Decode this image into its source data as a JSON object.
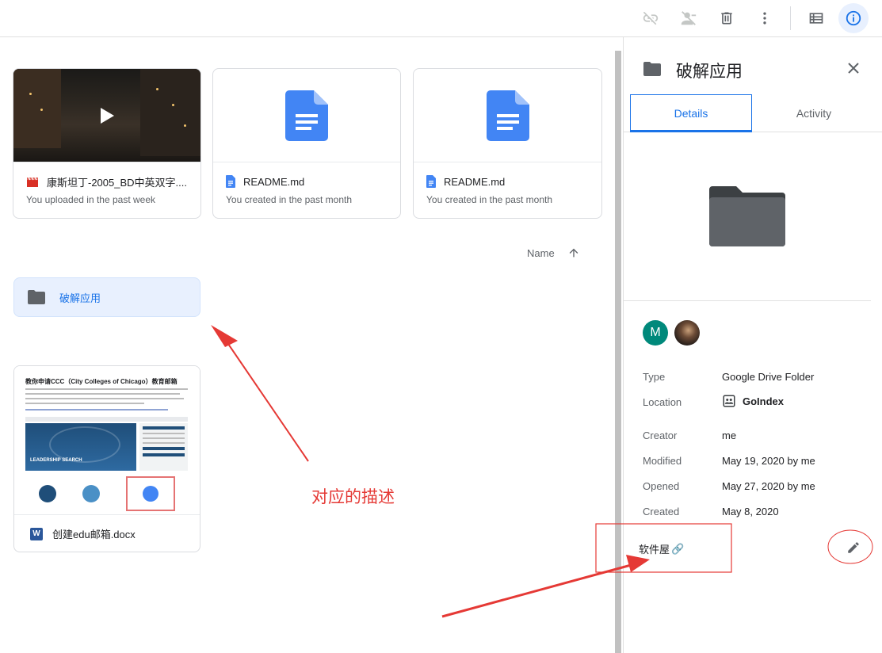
{
  "toolbar": {
    "icons": [
      "link-off-icon",
      "remove-person-icon",
      "trash-icon",
      "more-vert-icon",
      "list-view-icon",
      "info-icon"
    ]
  },
  "suggested": [
    {
      "title": "康斯坦丁-2005_BD中英双字....",
      "subtitle": "You uploaded in the past week",
      "type": "video"
    },
    {
      "title": "README.md",
      "subtitle": "You created in the past month",
      "type": "doc"
    },
    {
      "title": "README.md",
      "subtitle": "You created in the past month",
      "type": "doc"
    }
  ],
  "sort": {
    "label": "Name",
    "direction": "ascending"
  },
  "folders": [
    {
      "name": "破解应用"
    }
  ],
  "files": [
    {
      "name": "创建edu邮箱.docx",
      "type_badge": "W"
    }
  ],
  "doc_preview": {
    "heading": "教你申请CCC（City Colleges of Chicago）教育邮箱",
    "banner": "LEADERSHIP SEARCH"
  },
  "annotation": {
    "text": "对应的描述",
    "color": "#e53935"
  },
  "panel": {
    "title": "破解应用",
    "tabs": [
      {
        "label": "Details",
        "active": true
      },
      {
        "label": "Activity",
        "active": false
      }
    ],
    "avatar_initial": "M",
    "details": [
      {
        "label": "Type",
        "value": "Google Drive Folder"
      },
      {
        "label": "Location",
        "value": "GoIndex"
      },
      {
        "label": "Creator",
        "value": "me"
      },
      {
        "label": "Modified",
        "value": "May 19, 2020 by me"
      },
      {
        "label": "Opened",
        "value": "May 27, 2020 by me"
      },
      {
        "label": "Created",
        "value": "May 8, 2020"
      }
    ],
    "description": "软件屋",
    "description_emoji": "🔗"
  },
  "colors": {
    "accent": "#1a73e8",
    "folder": "#5f6368",
    "doc_blue": "#4285f4",
    "annotation": "#e53935"
  }
}
